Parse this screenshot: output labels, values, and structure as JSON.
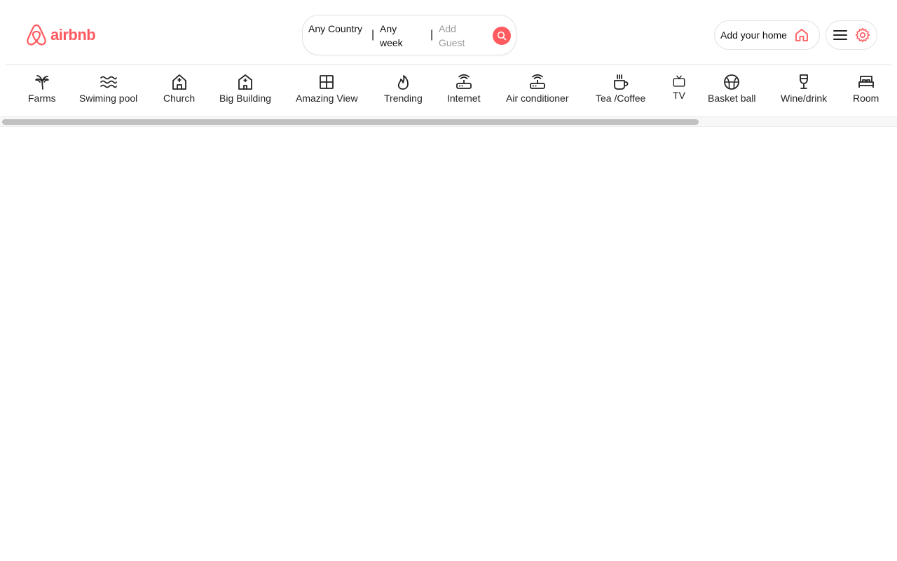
{
  "brand": {
    "name": "airbnb",
    "color": "#ff5a5f"
  },
  "search": {
    "country": "Any Country",
    "week": "Any week",
    "guest_placeholder": "Add Guest",
    "separator": "|"
  },
  "header": {
    "add_home_label": "Add your home"
  },
  "categories": [
    {
      "label": "Farms",
      "icon": "palm-tree-icon"
    },
    {
      "label": "Swiming pool",
      "icon": "waves-icon"
    },
    {
      "label": "Church",
      "icon": "church-icon"
    },
    {
      "label": "Big Building",
      "icon": "building-icon"
    },
    {
      "label": "Amazing View",
      "icon": "window-icon"
    },
    {
      "label": "Trending",
      "icon": "flame-icon"
    },
    {
      "label": "Internet",
      "icon": "router-icon"
    },
    {
      "label": "Air conditioner",
      "icon": "air-conditioner-icon"
    },
    {
      "label": "Tea /Coffee",
      "icon": "coffee-icon"
    },
    {
      "label": "TV",
      "icon": "tv-icon"
    },
    {
      "label": "Basket ball",
      "icon": "basketball-icon"
    },
    {
      "label": "Wine/drink",
      "icon": "wine-icon"
    },
    {
      "label": "Room",
      "icon": "bed-icon"
    }
  ]
}
